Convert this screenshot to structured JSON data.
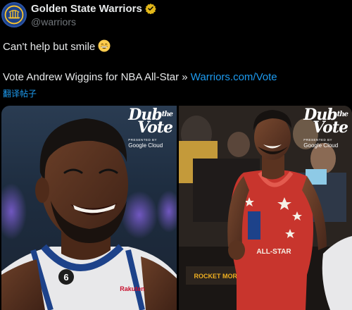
{
  "account": {
    "name": "Golden State Warriors",
    "handle": "@warriors"
  },
  "tweet": {
    "line1": "Can't help but smile",
    "line2_prefix": "Vote Andrew Wiggins for NBA All-Star » ",
    "link": "Warriors.com/Vote",
    "translate": "翻译帖子"
  },
  "media": {
    "left": {
      "brand_line1": "Dub",
      "brand_small": "the",
      "brand_line2": "Vote",
      "presented": "PRESENTED BY",
      "sponsor": "Google Cloud",
      "jersey_number": "6",
      "jersey_sponsor": "Rakuten"
    },
    "right": {
      "brand_line1": "Dub",
      "brand_small": "the",
      "brand_line2": "Vote",
      "presented": "PRESENTED BY",
      "sponsor": "Google Cloud",
      "jersey_text": "ALL-STAR",
      "courtside_sign": "ROCKET MORT"
    }
  },
  "colors": {
    "link": "#1d9bf0",
    "verified": "#e2b719",
    "warriors_blue": "#1d428a",
    "warriors_gold": "#ffc72c",
    "allstar_red": "#c8352d"
  },
  "icons": {
    "avatar": "warriors-logo-icon",
    "verified": "gold-verified-badge-icon",
    "emoji": "grinning-face-emoji-icon"
  }
}
